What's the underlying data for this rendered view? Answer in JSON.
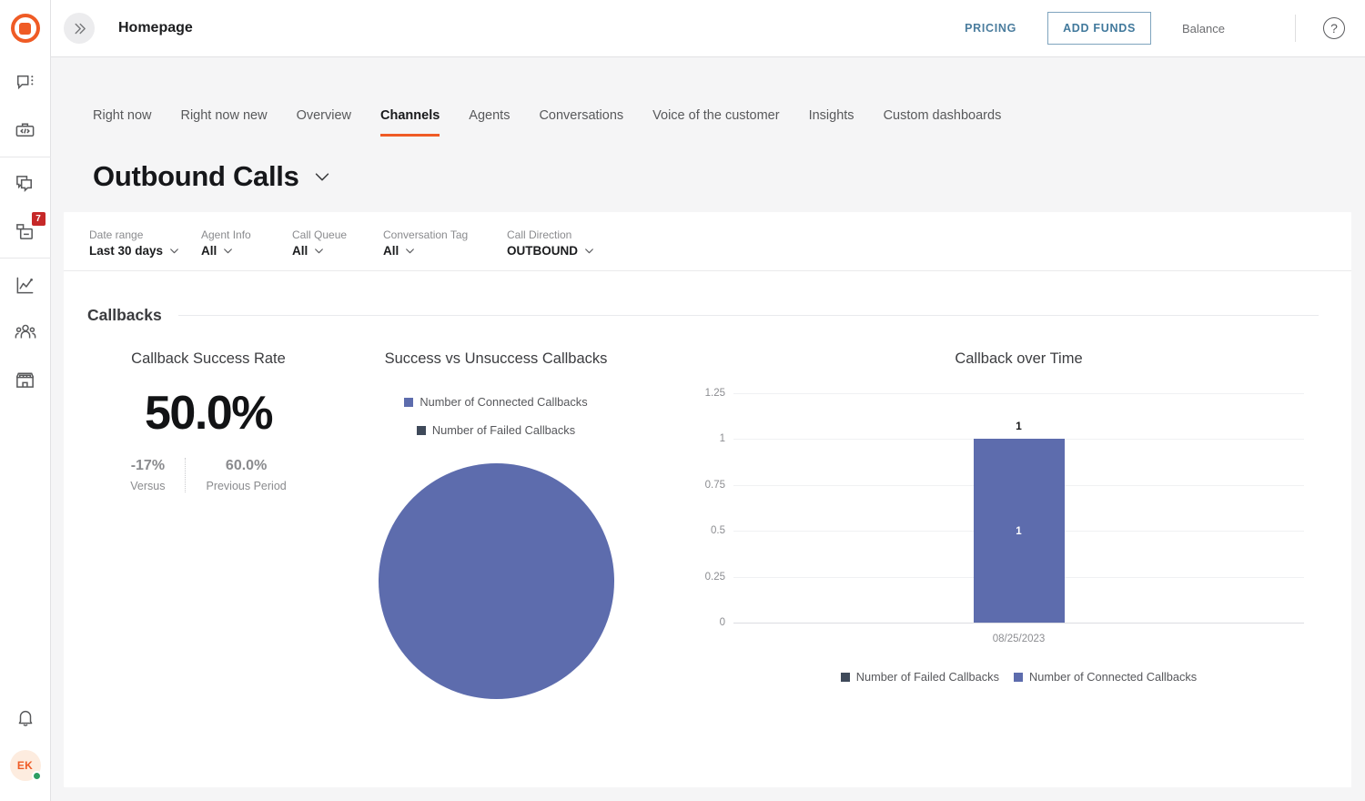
{
  "brand": {
    "logo_icon": "bullseye-logo",
    "accent": "#ef5b25"
  },
  "topbar": {
    "collapse_icon": "chevron-double-right-icon",
    "breadcrumb": "Homepage",
    "pricing_label": "PRICING",
    "add_funds_label": "ADD FUNDS",
    "balance_label": "Balance",
    "help_icon": "question-circle-icon",
    "help_glyph": "?"
  },
  "sidebar": {
    "groups": [
      {
        "items": [
          {
            "name": "chat-menu-icon",
            "label": "Chat"
          },
          {
            "name": "toolbox-code-icon",
            "label": "Developer tools"
          }
        ]
      },
      {
        "items": [
          {
            "name": "copy-conversations-icon",
            "label": "Conversations"
          },
          {
            "name": "inbox-icon",
            "label": "Inbox",
            "badge": "7"
          }
        ]
      },
      {
        "items": [
          {
            "name": "analytics-chart-icon",
            "label": "Analytics"
          },
          {
            "name": "team-people-icon",
            "label": "Team"
          },
          {
            "name": "storefront-icon",
            "label": "Marketplace"
          }
        ]
      }
    ],
    "bell_icon": "notification-bell-icon",
    "avatar_initials": "EK",
    "presence": "online"
  },
  "tabs": [
    {
      "label": "Right now",
      "active": false
    },
    {
      "label": "Right now new",
      "active": false
    },
    {
      "label": "Overview",
      "active": false
    },
    {
      "label": "Channels",
      "active": true
    },
    {
      "label": "Agents",
      "active": false
    },
    {
      "label": "Conversations",
      "active": false
    },
    {
      "label": "Voice of the customer",
      "active": false
    },
    {
      "label": "Insights",
      "active": false
    },
    {
      "label": "Custom dashboards",
      "active": false
    }
  ],
  "page": {
    "title": "Outbound Calls",
    "title_caret_icon": "chevron-down-icon"
  },
  "filters": [
    {
      "label": "Date range",
      "value": "Last 30 days"
    },
    {
      "label": "Agent Info",
      "value": "All"
    },
    {
      "label": "Call Queue",
      "value": "All"
    },
    {
      "label": "Conversation Tag",
      "value": "All"
    },
    {
      "label": "Call Direction",
      "value": "OUTBOUND"
    }
  ],
  "section": {
    "title": "Callbacks"
  },
  "kpi": {
    "title": "Callback Success Rate",
    "value": "50.0%",
    "delta": "-17%",
    "delta_caption": "Versus",
    "previous": "60.0%",
    "previous_caption": "Previous Period"
  },
  "colors": {
    "connected": "#5d6cad",
    "failed": "#3f4a5a"
  },
  "chart_data": [
    {
      "type": "pie",
      "title": "Success vs Unsuccess Callbacks",
      "legend_position": "top",
      "legend": [
        "Number of Connected Callbacks",
        "Number of Failed Callbacks"
      ],
      "categories": [
        "Number of Connected Callbacks",
        "Number of Failed Callbacks"
      ],
      "values": [
        1,
        0
      ],
      "colors": [
        "#5d6cad",
        "#3f4a5a"
      ]
    },
    {
      "type": "bar",
      "title": "Callback over Time",
      "categories": [
        "08/25/2023"
      ],
      "series": [
        {
          "name": "Number of Failed Callbacks",
          "values": [
            0
          ],
          "color": "#3f4a5a"
        },
        {
          "name": "Number of Connected Callbacks",
          "values": [
            1
          ],
          "color": "#5d6cad"
        }
      ],
      "bar_top_label": "1",
      "bar_inner_label": "1",
      "xlabel": "",
      "ylabel": "",
      "ylim": [
        0,
        1.25
      ],
      "yticks": [
        "1.25",
        "1",
        "0.75",
        "0.5",
        "0.25",
        "0"
      ],
      "ytick_values": [
        1.25,
        1,
        0.75,
        0.5,
        0.25,
        0
      ],
      "grid": true,
      "legend_position": "bottom",
      "legend": [
        "Number of Failed Callbacks",
        "Number of Connected Callbacks"
      ]
    }
  ]
}
